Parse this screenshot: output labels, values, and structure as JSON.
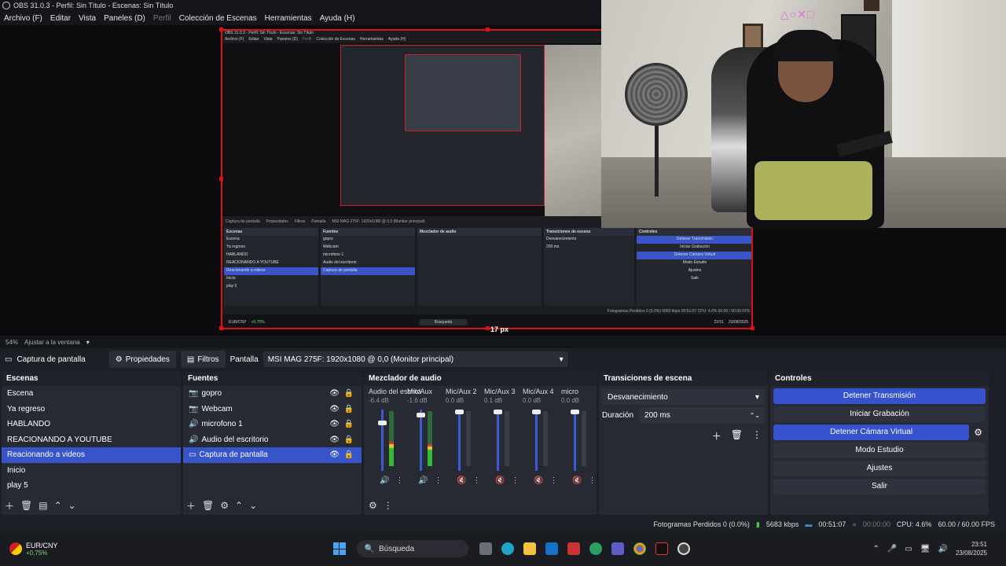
{
  "window": {
    "title": "OBS 31.0.3 - Perfil: Sin Título - Escenas: Sin Título"
  },
  "menu": [
    {
      "label": "Archivo (F)",
      "enabled": true
    },
    {
      "label": "Editar",
      "enabled": true
    },
    {
      "label": "Vista",
      "enabled": true
    },
    {
      "label": "Paneles (D)",
      "enabled": true
    },
    {
      "label": "Perfil",
      "enabled": false
    },
    {
      "label": "Colección de Escenas",
      "enabled": true
    },
    {
      "label": "Herramientas",
      "enabled": true
    },
    {
      "label": "Ayuda (H)",
      "enabled": true
    }
  ],
  "preview": {
    "size_label": "17 px",
    "zoom": "54%",
    "zoom_mode": "Ajustar a la ventana",
    "nested_title": "OBS 31.0.3 - Perfil: Sin Título - Escenas: Sin Título",
    "nested_menu": [
      "Archivo (F)",
      "Editar",
      "Vista",
      "Paneles (D)",
      "Perfil",
      "Colección de Escenas",
      "Herramientas",
      "Ayuda (H)"
    ],
    "nested_source_bar": [
      "Captura de pantalla",
      "Propiedades",
      "Filtros",
      "Pantalla",
      "MSI MAG 275F: 1920x1080 @ 0,0 (Monitor principal)"
    ],
    "nested_scenes": [
      "Escena",
      "Ya regreso",
      "HABLANDO",
      "REACIONANDO A YOUTUBE",
      "Reacionando a videos",
      "Inicio",
      "play 5"
    ],
    "nested_sources": [
      "gopro",
      "Webcam",
      "microfono 1",
      "Audio del escritorio",
      "Captura de pantalla"
    ],
    "nested_controls": [
      "Detener Transmisión",
      "Iniciar Grabación",
      "Detener Cámara Virtual",
      "Modo Estudio",
      "Ajustes",
      "Salir"
    ],
    "nested_status": "Fotogramas Perdidos 0 (0.0%)   5683 kbps   00:51:07   CPU: 4.6%   60.00 / 60.00 FPS",
    "nested_taskbar_search": "Búsqueda",
    "nested_tray_time": "23:51",
    "nested_tray_date": "23/08/2025",
    "nested_ticker": "EUR/CNY",
    "nested_ticker_change": "+0.75%"
  },
  "source_bar": {
    "current_source": "Captura de pantalla",
    "properties": "Propiedades",
    "filters": "Filtros",
    "display_label": "Pantalla",
    "display_value": "MSI MAG 275F: 1920x1080 @ 0,0 (Monitor principal)"
  },
  "scenes": {
    "title": "Escenas",
    "items": [
      {
        "label": "Escena",
        "selected": false
      },
      {
        "label": "Ya regreso",
        "selected": false
      },
      {
        "label": "HABLANDO",
        "selected": false
      },
      {
        "label": "REACIONANDO A YOUTUBE",
        "selected": false
      },
      {
        "label": "Reacionando a videos",
        "selected": true
      },
      {
        "label": "Inicio",
        "selected": false
      },
      {
        "label": "play 5",
        "selected": false
      }
    ]
  },
  "sources": {
    "title": "Fuentes",
    "items": [
      {
        "label": "gopro",
        "icon": "camera-icon",
        "selected": false
      },
      {
        "label": "Webcam",
        "icon": "camera-icon",
        "selected": false
      },
      {
        "label": "microfono 1",
        "icon": "speaker-icon",
        "selected": false
      },
      {
        "label": "Audio del escritorio",
        "icon": "speaker-icon",
        "selected": false
      },
      {
        "label": "Captura de pantalla",
        "icon": "monitor-icon",
        "selected": true
      }
    ]
  },
  "mixer": {
    "title": "Mezclador de audio",
    "channels": [
      {
        "name": "Audio del escrito",
        "db": "-6.4 dB",
        "level": 0.45,
        "volume": 0.8
      },
      {
        "name": "Mic/Aux",
        "db": "-1.6 dB",
        "level": 0.4,
        "volume": 0.95
      },
      {
        "name": "Mic/Aux 2",
        "db": "0.0 dB",
        "level": 0.0,
        "volume": 1.0
      },
      {
        "name": "Mic/Aux 3",
        "db": "0.1 dB",
        "level": 0.0,
        "volume": 1.0
      },
      {
        "name": "Mic/Aux 4",
        "db": "0.0 dB",
        "level": 0.0,
        "volume": 1.0
      },
      {
        "name": "micro",
        "db": "0.0 dB",
        "level": 0.0,
        "volume": 1.0
      }
    ],
    "scale": [
      "0",
      "-5",
      "-10",
      "-15",
      "-20",
      "-25",
      "-30",
      "-35",
      "-40",
      "-45",
      "-50",
      "-55",
      "-60"
    ]
  },
  "transitions": {
    "title": "Transiciones de escena",
    "type": "Desvanecimiento",
    "duration_label": "Duración",
    "duration_value": "200 ms"
  },
  "controls": {
    "title": "Controles",
    "buttons": [
      {
        "label": "Detener Transmisión",
        "active": true
      },
      {
        "label": "Iniciar Grabación",
        "active": false
      },
      {
        "label": "Detener Cámara Virtual",
        "active": true
      },
      {
        "label": "Modo Estudio",
        "active": false
      },
      {
        "label": "Ajustes",
        "active": false
      },
      {
        "label": "Salir",
        "active": false
      }
    ]
  },
  "status": {
    "dropped": "Fotogramas Perdidos 0 (0.0%)",
    "bitrate": "5683 kbps",
    "stream_time": "00:51:07",
    "rec_time": "00:00:00",
    "cpu": "CPU: 4.6%",
    "fps": "60.00 / 60.00 FPS"
  },
  "taskbar": {
    "ticker": "EUR/CNY",
    "ticker_change": "+0,75%",
    "search": "Búsqueda",
    "time": "23:51",
    "date": "23/08/2025"
  },
  "colors": {
    "accent": "#3754c8",
    "selection_border": "#dd1111",
    "panel": "#272a33",
    "background": "#1d1f26"
  }
}
